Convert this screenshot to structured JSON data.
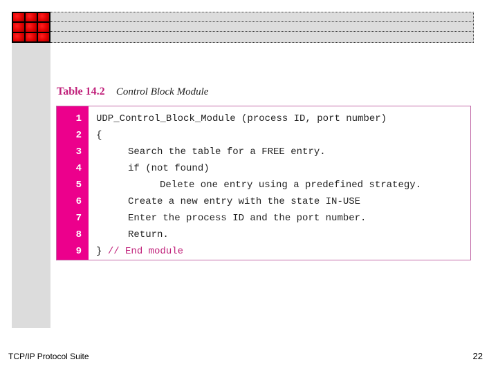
{
  "table": {
    "number": "Table 14.2",
    "title": "Control Block Module",
    "lines": [
      {
        "no": "1",
        "indent": 0,
        "text": "UDP_Control_Block_Module (process ID, port number)",
        "comment": ""
      },
      {
        "no": "2",
        "indent": 0,
        "text": "{",
        "comment": ""
      },
      {
        "no": "3",
        "indent": 1,
        "text": "Search the table for a FREE entry.",
        "comment": ""
      },
      {
        "no": "4",
        "indent": 1,
        "text": "if (not found)",
        "comment": ""
      },
      {
        "no": "5",
        "indent": 2,
        "text": "Delete one entry using a predefined strategy.",
        "comment": ""
      },
      {
        "no": "6",
        "indent": 1,
        "text": "Create a new entry with the state IN-USE",
        "comment": ""
      },
      {
        "no": "7",
        "indent": 1,
        "text": "Enter the process ID and the port number.",
        "comment": ""
      },
      {
        "no": "8",
        "indent": 1,
        "text": "Return.",
        "comment": ""
      },
      {
        "no": "9",
        "indent": 0,
        "text": "} ",
        "comment": "// End module"
      }
    ]
  },
  "footer": {
    "left": "TCP/IP Protocol Suite",
    "page_number": "22"
  },
  "colors": {
    "accent": "#ec008c",
    "caption_number": "#c0207a",
    "logo_red": "#e00000",
    "sidebar_gray": "#dcdcdc"
  }
}
